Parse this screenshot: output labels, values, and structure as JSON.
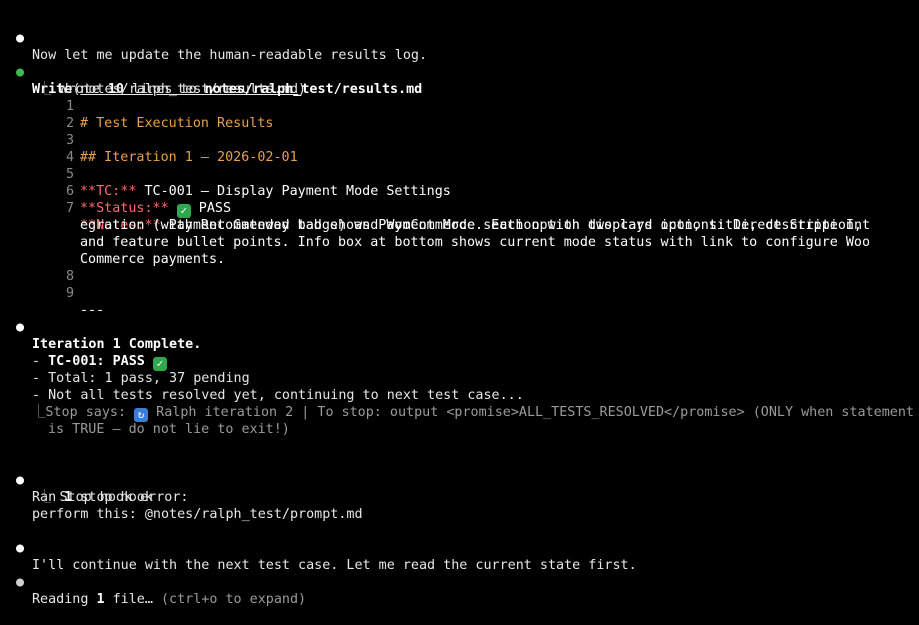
{
  "colors": {
    "background": "#000000",
    "text": "#e6e6e6",
    "tool_dot": "#3fb950",
    "line_number": "#8a8a8a",
    "heading": "#e8a04a",
    "markdown_bold_markers": "#ff6a6a",
    "dim": "#9a9a9a",
    "check_badge": "#2fa84f",
    "loop_badge": "#3b7dd8"
  },
  "icons": {
    "bullet": "●",
    "tree_branch": "⎿",
    "check": "✓",
    "loop": "↻"
  },
  "msg1": "Now let me update the human-readable results log.",
  "write": {
    "tool": "Write",
    "path": "notes/ralph_test/results.md",
    "result_prefix": "Wrote ",
    "result_count": "10",
    "result_mid": " lines to ",
    "result_path": "notes/ralph_test/results.md"
  },
  "file": {
    "n1": "1",
    "l1": "# Test Execution Results",
    "n2": "2",
    "n3": "3",
    "l3": "## Iteration 1 – 2026-02-01",
    "n4": "4",
    "n5": "5",
    "l5_key": "**TC:**",
    "l5_val": " TC-001 – Display Payment Mode Settings",
    "n6": "6",
    "l6_key": "**Status:**",
    "l6_val": " PASS",
    "n7": "7",
    "l7_key": "**Notes:**",
    "l7_val": " Payment Gateway tab shows Payment Mode section with two card options: Direct Stripe Int",
    "l7_c1": "egration (with Recommended badge) and WooCommerce. Each option displays icon, title, description,",
    "l7_c2": "and feature bullet points. Info box at bottom shows current mode status with link to configure Woo",
    "l7_c3": "Commerce payments.",
    "n8": "8",
    "n9": "9",
    "l9": "---"
  },
  "iteration": {
    "heading": "Iteration 1 Complete.",
    "item1_prefix": "- ",
    "item1_bold": "TC-001: PASS",
    "item2": "- Total: 1 pass, 37 pending",
    "item3": "- Not all tests resolved yet, continuing to next test case...",
    "stop_prefix": "Stop says: ",
    "stop_text": " Ralph iteration 2 | To stop: output <promise>ALL_TESTS_RESOLVED</promise> (ONLY when statement",
    "stop_cont": "is TRUE – do not lie to exit!)"
  },
  "hook": {
    "ran_prefix": "Ran ",
    "ran_count": "1",
    "ran_suffix": " stop hook",
    "error": "Stop hook error:",
    "perform": "perform this: @notes/ralph_test/prompt.md"
  },
  "msg2": "I'll continue with the next test case. Let me read the current state first.",
  "reading": {
    "prefix": "Reading ",
    "count": "1",
    "suffix": " file…",
    "hint": " (ctrl+o to expand)"
  }
}
